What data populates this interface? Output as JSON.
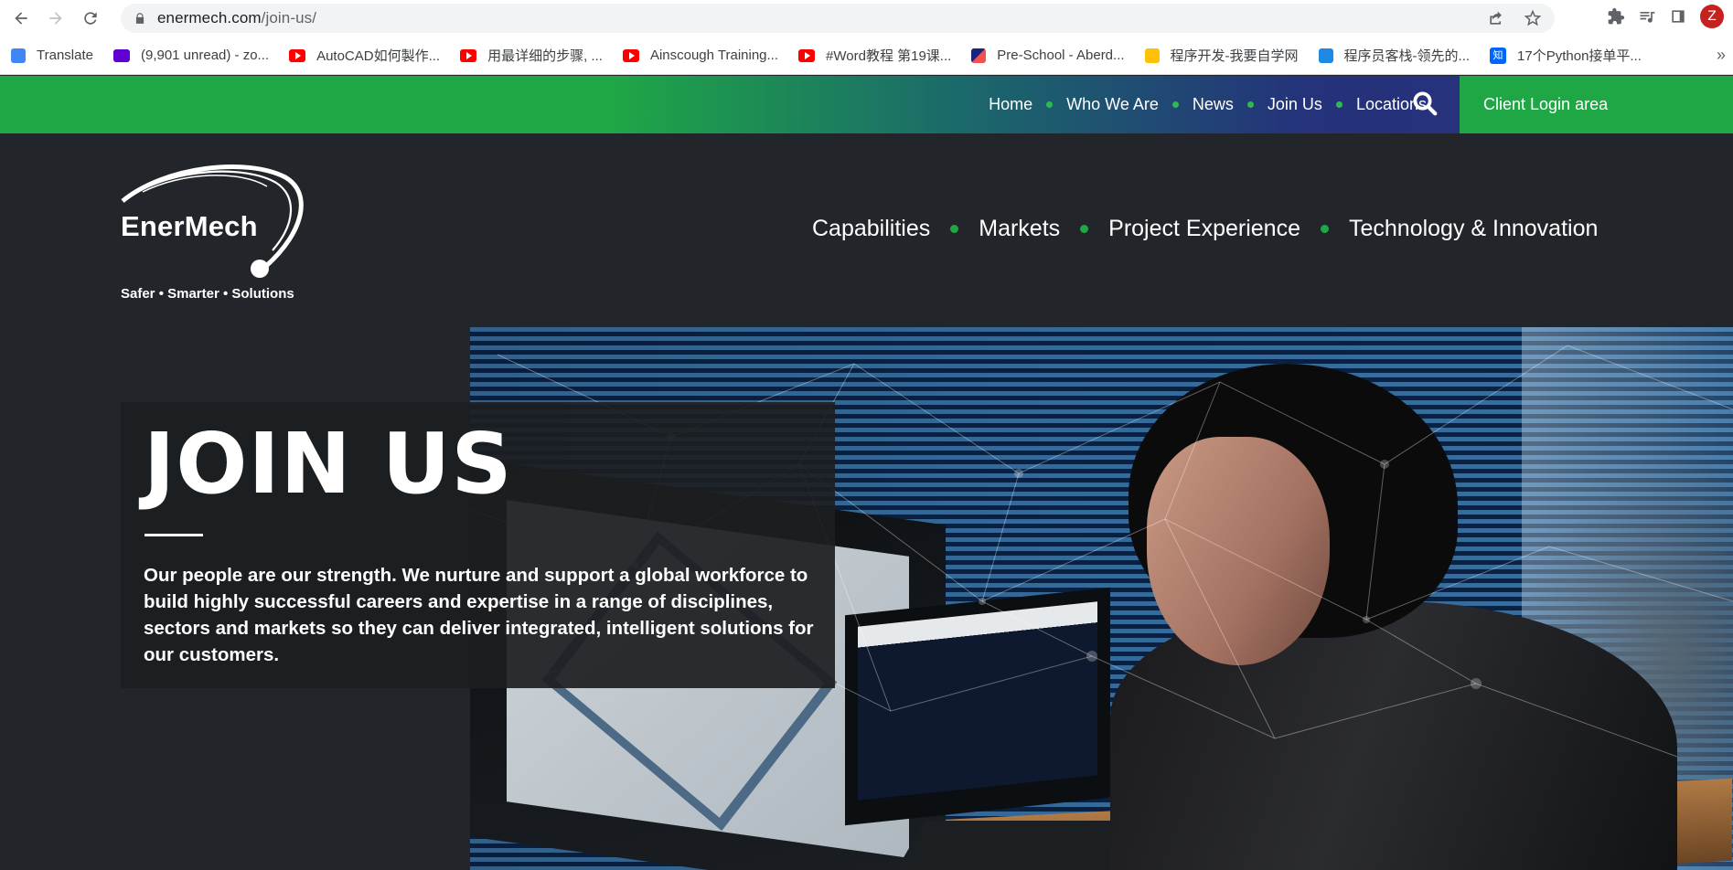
{
  "browser": {
    "url_host": "enermech.com",
    "url_path": "/join-us/",
    "avatar_letter": "Z",
    "bookmarks": [
      {
        "label": "Translate",
        "icon": "google-translate-icon"
      },
      {
        "label": "(9,901 unread) - zo...",
        "icon": "mail-icon"
      },
      {
        "label": "AutoCAD如何製作...",
        "icon": "youtube-icon"
      },
      {
        "label": "用最详细的步骤, ...",
        "icon": "youtube-icon"
      },
      {
        "label": "Ainscough Training...",
        "icon": "youtube-icon"
      },
      {
        "label": "#Word教程 第19课...",
        "icon": "youtube-icon"
      },
      {
        "label": "Pre-School - Aberd...",
        "icon": "school-icon"
      },
      {
        "label": "程序开发-我要自学网",
        "icon": "site-icon"
      },
      {
        "label": "程序员客栈-领先的...",
        "icon": "terminal-icon"
      },
      {
        "label": "17个Python接单平...",
        "icon": "zhihu-icon"
      }
    ],
    "more_label": "»"
  },
  "site": {
    "topnav": [
      "Home",
      "Who We Are",
      "News",
      "Join Us",
      "Locations"
    ],
    "client_login": "Client Login area",
    "logo_word": "EnerMech",
    "logo_tagline": "Safer • Smarter • Solutions",
    "mainnav": [
      "Capabilities",
      "Markets",
      "Project Experience",
      "Technology & Innovation"
    ],
    "hero": {
      "title": "JOIN US",
      "text": "Our people are our strength. We nurture and support a global workforce to build highly successful careers and expertise in a range of disciplines, sectors and markets so they can deliver integrated, intelligent solutions for our customers."
    }
  },
  "colors": {
    "brand_green": "#1fa745",
    "brand_navy": "#2a2f7d",
    "page_dark": "#222529"
  }
}
